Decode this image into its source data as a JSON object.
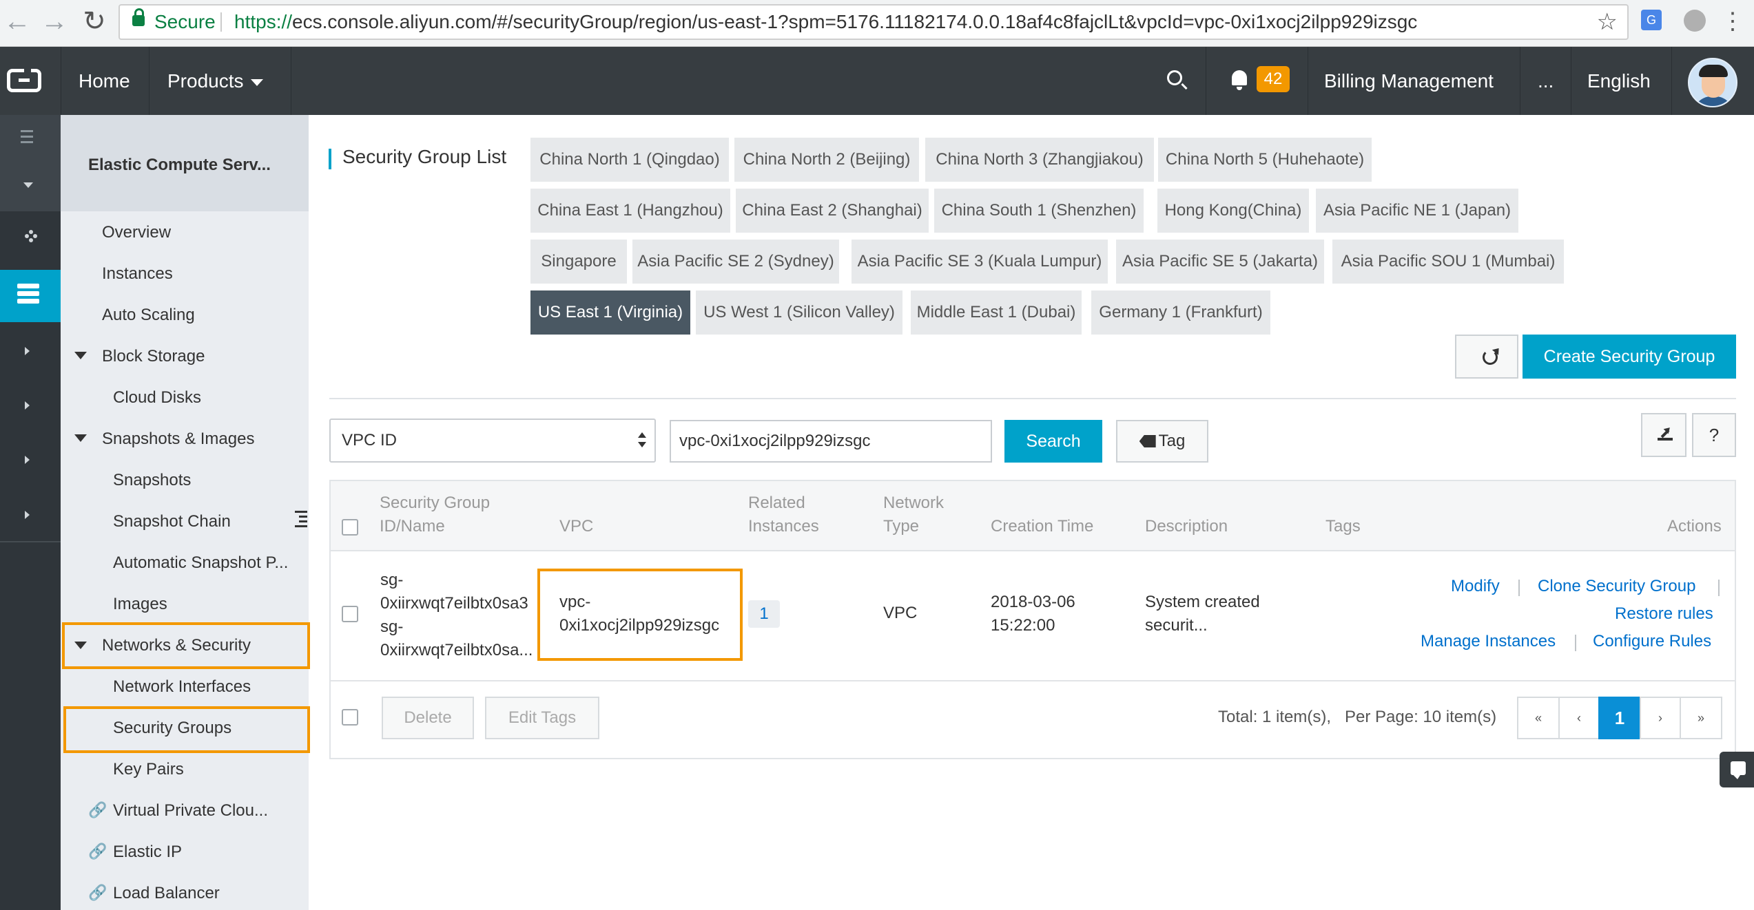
{
  "browser": {
    "secure_label": "Secure",
    "url_scheme": "https://",
    "url_rest": "ecs.console.aliyun.com/#/securityGroup/region/us-east-1?spm=5176.11182174.0.0.18af4c8fajclLt&vpcId=vpc-0xi1xocj2ilpp929izsgc"
  },
  "topnav": {
    "home": "Home",
    "products": "Products",
    "notifications_count": "42",
    "billing": "Billing Management",
    "more": "...",
    "language": "English"
  },
  "sidebar": {
    "title": "Elastic Compute Serv...",
    "items": [
      {
        "label": "Overview"
      },
      {
        "label": "Instances"
      },
      {
        "label": "Auto Scaling"
      },
      {
        "label": "Block Storage"
      },
      {
        "label": "Cloud Disks"
      },
      {
        "label": "Snapshots & Images"
      },
      {
        "label": "Snapshots"
      },
      {
        "label": "Snapshot Chain"
      },
      {
        "label": "Automatic Snapshot P..."
      },
      {
        "label": "Images"
      },
      {
        "label": "Networks & Security"
      },
      {
        "label": "Network Interfaces"
      },
      {
        "label": "Security Groups"
      },
      {
        "label": "Key Pairs"
      },
      {
        "label": "Virtual Private Clou..."
      },
      {
        "label": "Elastic IP"
      },
      {
        "label": "Load Balancer"
      }
    ]
  },
  "main": {
    "title": "Security Group List",
    "regions": [
      "China North 1 (Qingdao)",
      "China North 2 (Beijing)",
      "China North 3 (Zhangjiakou)",
      "China North 5 (Huhehaote)",
      "China East 1 (Hangzhou)",
      "China East 2 (Shanghai)",
      "China South 1 (Shenzhen)",
      "Hong Kong(China)",
      "Asia Pacific NE 1 (Japan)",
      "Singapore",
      "Asia Pacific SE 2 (Sydney)",
      "Asia Pacific SE 3 (Kuala Lumpur)",
      "Asia Pacific SE 5 (Jakarta)",
      "Asia Pacific SOU 1 (Mumbai)",
      "US East 1 (Virginia)",
      "US West 1 (Silicon Valley)",
      "Middle East 1 (Dubai)",
      "Germany 1 (Frankfurt)"
    ],
    "active_region": "US East 1 (Virginia)",
    "create_button": "Create Security Group",
    "filter_select": "VPC ID",
    "filter_value": "vpc-0xi1xocj2ilpp929izsgc",
    "search_button": "Search",
    "tag_button": "Tag",
    "help": "?"
  },
  "table": {
    "headers": {
      "id_line1": "Security Group",
      "id_line2": "ID/Name",
      "vpc": "VPC",
      "related_line1": "Related",
      "related_line2": "Instances",
      "net_line1": "Network",
      "net_line2": "Type",
      "created": "Creation Time",
      "description": "Description",
      "tags": "Tags",
      "actions": "Actions"
    },
    "rows": [
      {
        "id_l1": "sg-",
        "id_l2": "0xiirxwqt7eilbtx0sa3",
        "name_l1": "sg-",
        "name_l2": "0xiirxwqt7eilbtx0sa...",
        "vpc_l1": "vpc-",
        "vpc_l2": "0xi1xocj2ilpp929izsgc",
        "related": "1",
        "network_type": "VPC",
        "created_date": "2018-03-06",
        "created_time": "15:22:00",
        "desc_l1": "System created",
        "desc_l2": "securit...",
        "actions": {
          "modify": "Modify",
          "clone": "Clone Security Group",
          "restore": "Restore rules",
          "manage": "Manage Instances",
          "configure": "Configure Rules"
        }
      }
    ],
    "footer": {
      "delete": "Delete",
      "edit_tags": "Edit Tags",
      "total": "Total: 1 item(s),",
      "per_page": "Per Page: 10 item(s)",
      "pager": {
        "first": "«",
        "prev": "‹",
        "current": "1",
        "next": "›",
        "last": "»"
      }
    }
  }
}
